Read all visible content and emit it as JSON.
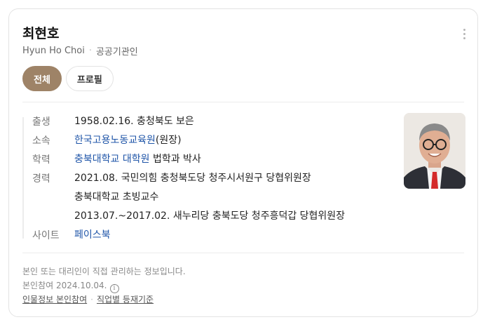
{
  "person": {
    "name": "최현호",
    "name_en": "Hyun Ho Choi",
    "category": "공공기관인"
  },
  "tabs": [
    {
      "label": "전체",
      "active": true
    },
    {
      "label": "프로필",
      "active": false
    }
  ],
  "info": {
    "birth": {
      "label": "출생",
      "value": "1958.02.16. 충청북도 보은"
    },
    "affiliation": {
      "label": "소속",
      "link": "한국고용노동교육원",
      "suffix": "(원장)"
    },
    "education": {
      "label": "학력",
      "link": "충북대학교 대학원",
      "suffix": " 법학과 박사"
    },
    "career": {
      "label": "경력",
      "items": [
        "2021.08. 국민의힘 충청북도당 청주시서원구 당협위원장",
        "충북대학교 초빙교수",
        "2013.07.~2017.02. 새누리당 충북도당 청주흥덕갑 당협위원장"
      ]
    },
    "site": {
      "label": "사이트",
      "link": "페이스북"
    }
  },
  "footer": {
    "notice": "본인 또는 대리인이 직접 관리하는 정보입니다.",
    "participation": "본인참여 2024.10.04.",
    "info_icon": "i",
    "links": [
      "인물정보 본인참여",
      "직업별 등재기준"
    ]
  },
  "colors": {
    "accent": "#9e8367",
    "link": "#1f55a8"
  },
  "icons": {
    "more": "vertical-ellipsis",
    "info": "info-circle"
  }
}
